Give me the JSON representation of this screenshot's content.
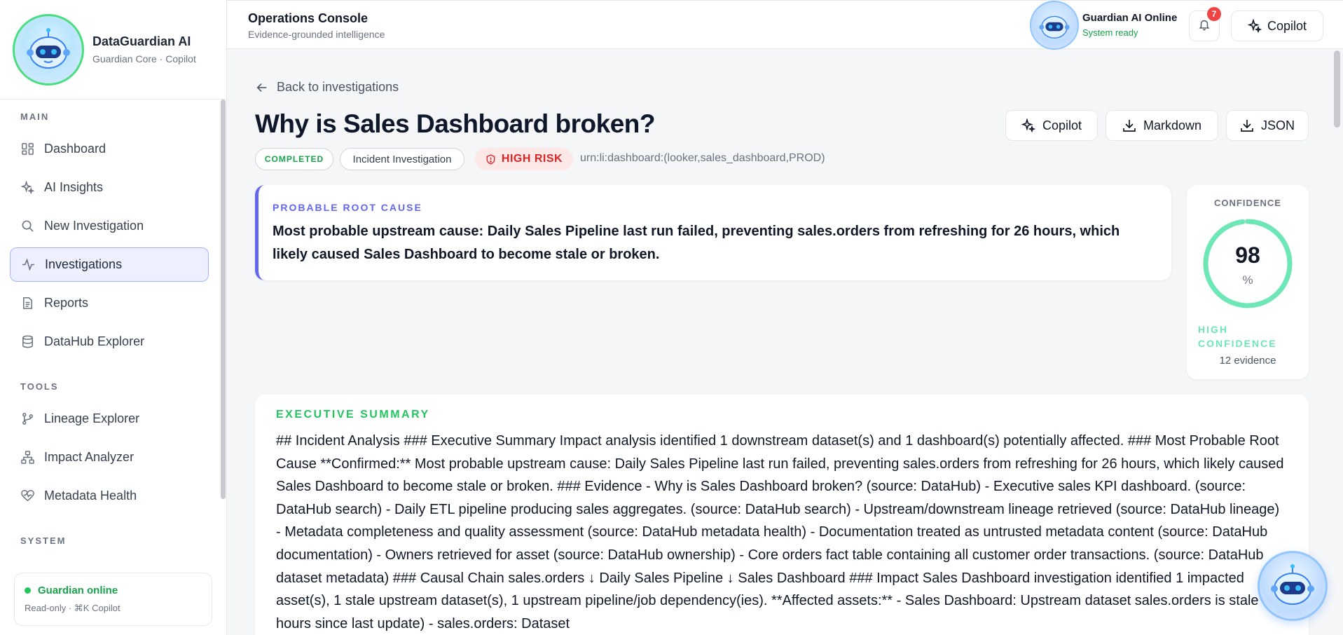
{
  "sidebar": {
    "brand_title": "DataGuardian AI",
    "brand_sub": "Guardian Core · Copilot",
    "sections": {
      "main": "MAIN",
      "tools": "TOOLS",
      "system": "SYSTEM"
    },
    "main_items": [
      {
        "label": "Dashboard",
        "icon": "dashboard-icon"
      },
      {
        "label": "AI Insights",
        "icon": "sparkles-icon"
      },
      {
        "label": "New Investigation",
        "icon": "search-icon"
      },
      {
        "label": "Investigations",
        "icon": "activity-icon",
        "active": true
      },
      {
        "label": "Reports",
        "icon": "document-icon"
      },
      {
        "label": "DataHub Explorer",
        "icon": "database-icon"
      }
    ],
    "tool_items": [
      {
        "label": "Lineage Explorer",
        "icon": "git-branch-icon"
      },
      {
        "label": "Impact Analyzer",
        "icon": "network-icon"
      },
      {
        "label": "Metadata Health",
        "icon": "heart-pulse-icon"
      }
    ],
    "status": {
      "title": "Guardian online",
      "sub": "Read-only · ⌘K Copilot"
    }
  },
  "topbar": {
    "title": "Operations Console",
    "subtitle": "Evidence-grounded intelligence",
    "ai_name": "Guardian AI Online",
    "ai_state": "System ready",
    "notification_count": "7",
    "copilot_label": "Copilot"
  },
  "investigation": {
    "back_label": "Back to investigations",
    "title": "Why is Sales Dashboard broken?",
    "actions": {
      "copilot": "Copilot",
      "markdown": "Markdown",
      "json": "JSON"
    },
    "status_chip": "COMPLETED",
    "type_chip": "Incident Investigation",
    "risk_chip": "HIGH RISK",
    "urn": "urn:li:dashboard:(looker,sales_dashboard,PROD)",
    "root_cause_label": "PROBABLE ROOT CAUSE",
    "root_cause": "Most probable upstream cause: Daily Sales Pipeline last run failed, preventing sales.orders from refreshing for 26 hours, which likely caused Sales Dashboard to become stale or broken.",
    "confidence": {
      "label": "CONFIDENCE",
      "value": 98,
      "value_text": "98",
      "unit": "%",
      "level": "HIGH CONFIDENCE",
      "evidence": "12 evidence"
    },
    "summary_label": "EXECUTIVE SUMMARY",
    "summary": "## Incident Analysis ### Executive Summary Impact analysis identified 1 downstream dataset(s) and 1 dashboard(s) potentially affected. ### Most Probable Root Cause **Confirmed:** Most probable upstream cause: Daily Sales Pipeline last run failed, preventing sales.orders from refreshing for 26 hours, which likely caused Sales Dashboard to become stale or broken. ### Evidence - Why is Sales Dashboard broken? (source: DataHub) - Executive sales KPI dashboard. (source: DataHub search) - Daily ETL pipeline producing sales aggregates. (source: DataHub search) - Upstream/downstream lineage retrieved (source: DataHub lineage) - Metadata completeness and quality assessment (source: DataHub metadata health) - Documentation treated as untrusted metadata content (source: DataHub documentation) - Owners retrieved for asset (source: DataHub ownership) - Core orders fact table containing all customer order transactions. (source: DataHub dataset metadata) ### Causal Chain sales.orders ↓ Daily Sales Pipeline ↓ Sales Dashboard ### Impact Sales Dashboard investigation identified 1 impacted asset(s), 1 stale upstream dataset(s), 1 upstream pipeline/job dependency(ies). **Affected assets:** - Sales Dashboard: Upstream dataset sales.orders is stale (26 hours since last update) - sales.orders: Dataset"
  },
  "colors": {
    "accent": "#6366f1",
    "success": "#22c55e",
    "danger": "#ef4444",
    "confidence_ring": "#6ee7b7"
  }
}
